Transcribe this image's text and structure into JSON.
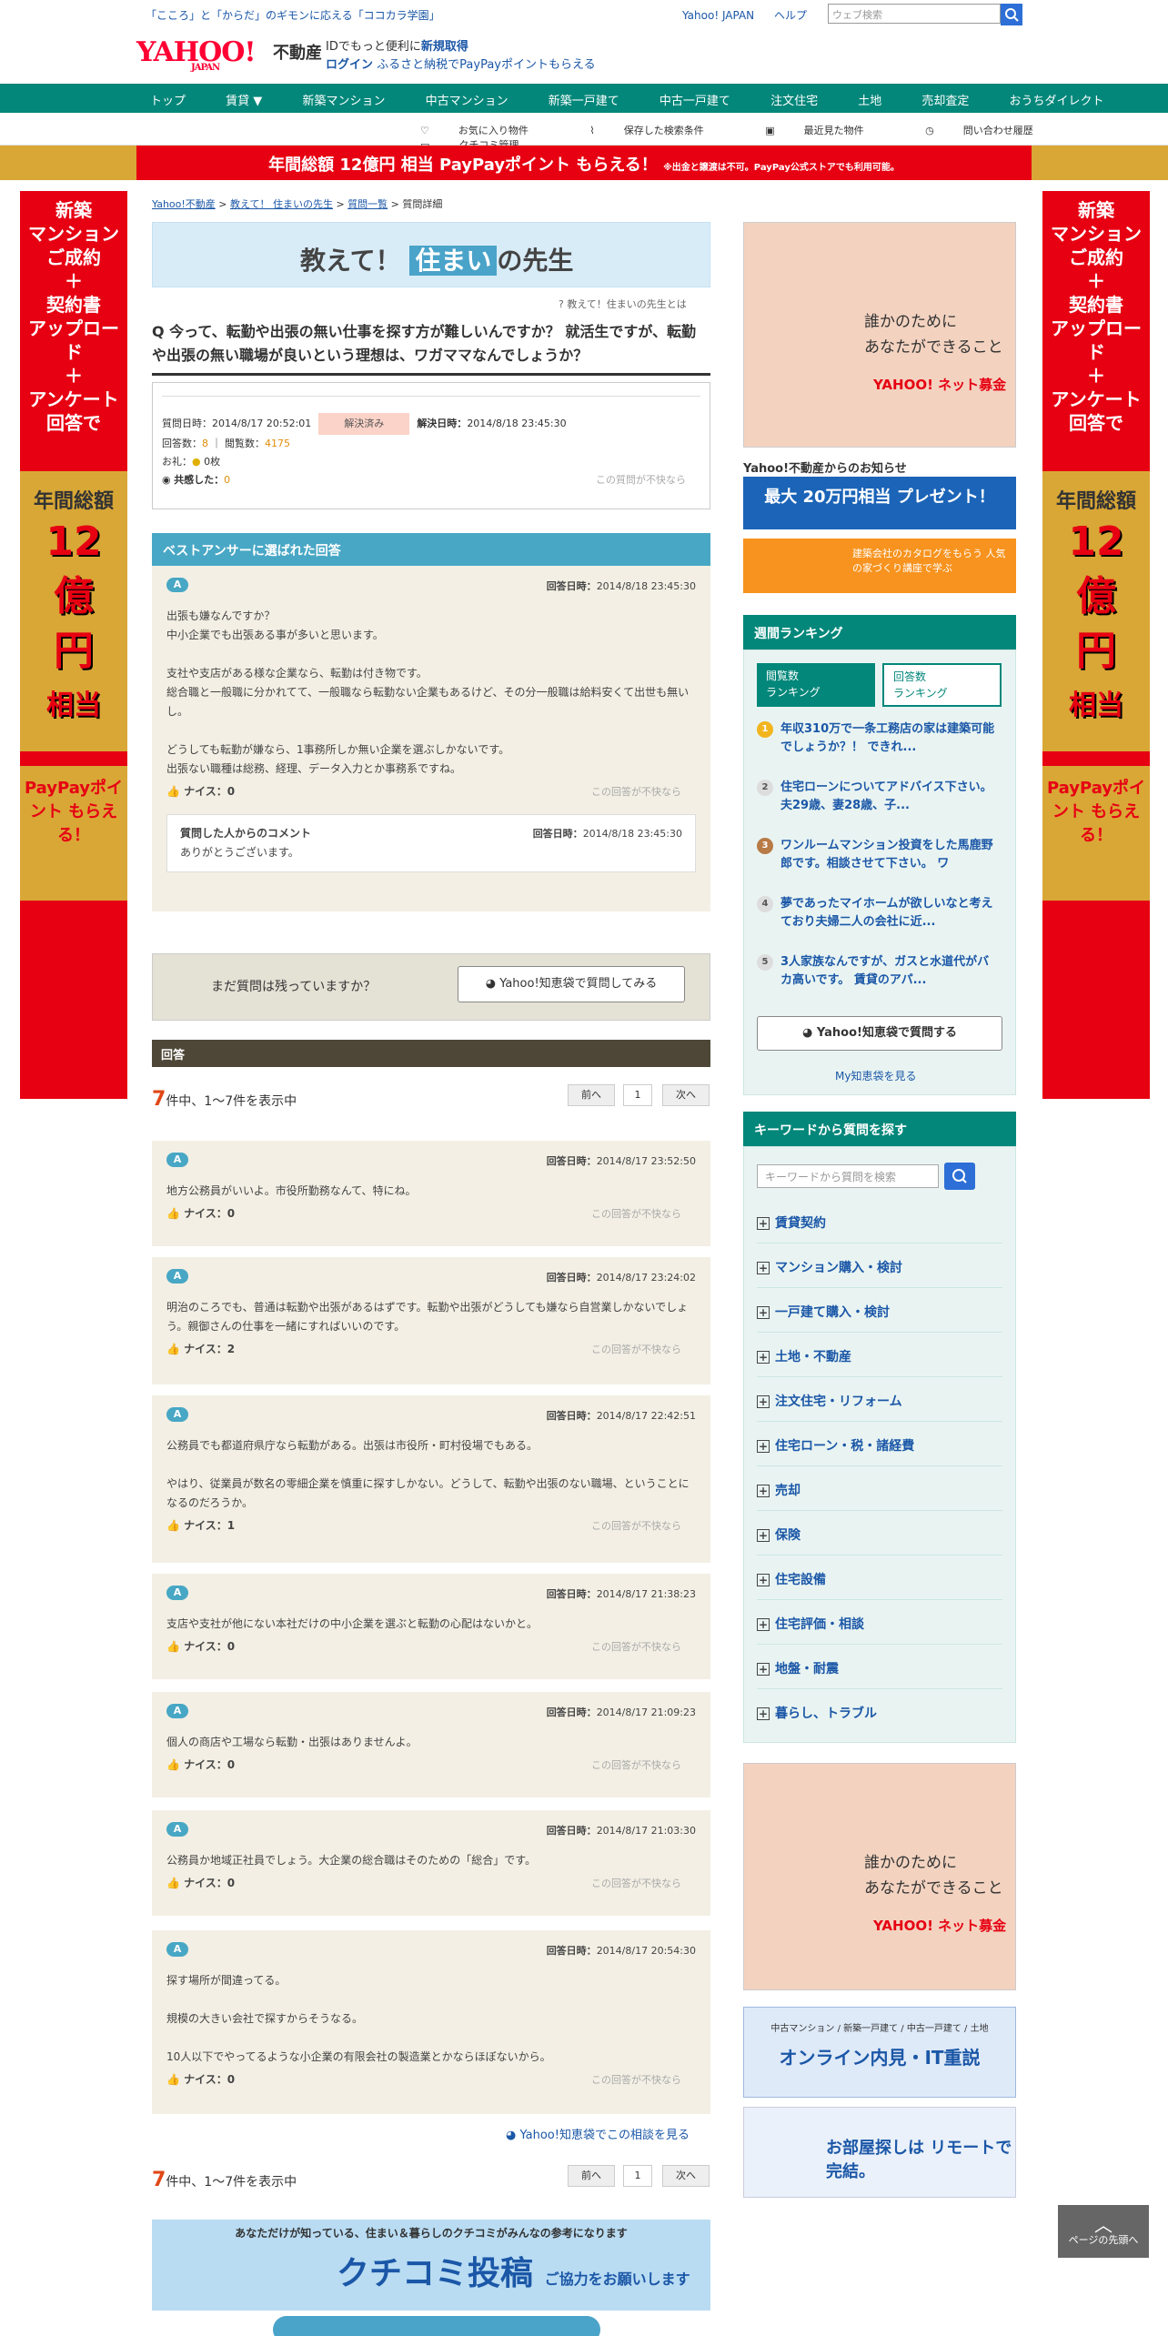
{
  "header": {
    "tagline": "「こころ」と「からだ」のギモンに応える「ココカラ学園」",
    "links": [
      "Yahoo! JAPAN",
      "ヘルプ"
    ],
    "search_placeholder": "ウェブ検索",
    "logo": "YAHOO!",
    "logo_sub": "JAPAN",
    "site_name": "不動産",
    "id_line1_a": "IDでもっと便利に",
    "id_line1_b": "新規取得",
    "id_line2_a": "ログイン",
    "id_line2_b": "ふるさと納税でPayPayポイントもらえる"
  },
  "global_nav": [
    "トップ",
    "賃貸 ▼",
    "新築マンション",
    "中古マンション",
    "新築一戸建て",
    "中古一戸建て",
    "注文住宅",
    "土地",
    "売却査定",
    "おうちダイレクト"
  ],
  "sub_nav": [
    "お気に入り物件",
    "保存した検索条件",
    "最近見た物件",
    "問い合わせ履歴",
    "クチコミ管理"
  ],
  "banner": {
    "text": "年間総額 12億円 相当 PayPayポイント もらえる！",
    "note": "※出金と譲渡は不可。PayPay公式ストアでも利用可能。"
  },
  "side_ad": {
    "line1": "新築\nマンション\nご成約\n＋\n契約書\nアップロード\n＋\nアンケート\n回答で",
    "total": "年間総額",
    "amount": "12億円",
    "equiv": "相当",
    "paypay": "PayPayポイント もらえる！"
  },
  "breadcrumb": [
    "Yahoo!不動産",
    "教えて！ 住まいの先生",
    "質問一覧",
    "質問詳細"
  ],
  "hero": {
    "t1": "教えて！",
    "t2": "住まい",
    "t3": "の先生",
    "about": "教えて！住まいの先生とは"
  },
  "question": {
    "title": "今って、転勤や出張の無い仕事を探す方が難しいんですか？ 就活生ですが、転勤や出張の無い職場が良いという理想は、ワガママなんでしょうか？",
    "asked_label": "質問日時：",
    "asked": "2014/8/17 20:52:01",
    "status": "解決済み",
    "resolved_label": "解決日時：",
    "resolved": "2014/8/18 23:45:30",
    "answers_label": "回答数：",
    "answers": "8",
    "views_label": "閲覧数：",
    "views": "4175",
    "thanks_label": "お礼：",
    "thanks": "0枚",
    "empathy_label": "共感した：",
    "empathy": "0",
    "inappropriate": "この質問が不快なら"
  },
  "best": {
    "header": "ベストアンサーに選ばれた回答",
    "date_label": "回答日時：",
    "date": "2014/8/18 23:45:30",
    "body": "出張も嫌なんですか？\n中小企業でも出張ある事が多いと思います。\n\n支社や支店がある様な企業なら、転勤は付き物です。\n総合職と一般職に分かれてて、一般職なら転勤ない企業もあるけど、その分一般職は給料安くて出世も無いし。\n\nどうしても転勤が嫌なら、1事務所しか無い企業を選ぶしかないです。\n出張ない職種は総務、経理、データ入力とか事務系ですね。",
    "nice": "ナイス：0",
    "inappropriate": "この回答が不快なら",
    "comment_title": "質問した人からのコメント",
    "comment_date_label": "回答日時：",
    "comment_date": "2014/8/18 23:45:30",
    "comment_body": "ありがとうございます。"
  },
  "more_q": {
    "text": "まだ質問は残っていますか？",
    "button": "Yahoo!知恵袋で質問してみる"
  },
  "answers_header": "回答",
  "count": {
    "num": "7",
    "text": "件中、1～7件を表示中"
  },
  "pager": {
    "prev": "前へ",
    "page": "1",
    "next": "次へ"
  },
  "answers": [
    {
      "date": "2014/8/17 23:52:50",
      "body": "地方公務員がいいよ。市役所勤務なんて、特にね。",
      "nice": "ナイス：0"
    },
    {
      "date": "2014/8/17 23:24:02",
      "body": "明治のころでも、普通は転勤や出張があるはずです。転勤や出張がどうしても嫌なら自営業しかないでしょう。親御さんの仕事を一緒にすればいいのです。",
      "nice": "ナイス：2"
    },
    {
      "date": "2014/8/17 22:42:51",
      "body": "公務員でも都道府県庁なら転勤がある。出張は市役所・町村役場でもある。\n\nやはり、従業員が数名の零細企業を慎重に探すしかない。どうして、転勤や出張のない職場、ということになるのだろうか。",
      "nice": "ナイス：1"
    },
    {
      "date": "2014/8/17 21:38:23",
      "body": "支店や支社が他にない本社だけの中小企業を選ぶと転勤の心配はないかと。",
      "nice": "ナイス：0"
    },
    {
      "date": "2014/8/17 21:09:23",
      "body": "個人の商店や工場なら転勤・出張はありませんよ。",
      "nice": "ナイス：0"
    },
    {
      "date": "2014/8/17 21:03:30",
      "body": "公務員か地域正社員でしょう。大企業の総合職はそのための「総合」です。",
      "nice": "ナイス：0"
    },
    {
      "date": "2014/8/17 20:54:30",
      "body": "探す場所が間違ってる。\n\n規模の大きい会社で探すからそうなる。\n\n10人以下でやってるような小企業の有限会社の製造業とかならほぼないから。",
      "nice": "ナイス：0"
    }
  ],
  "answer_labels": {
    "date_label": "回答日時：",
    "inappropriate": "この回答が不快なら",
    "badge": "A"
  },
  "see_more": "Yahoo!知恵袋でこの相談を見る",
  "kuchikomi": {
    "line": "あなただけが知っている、住まい＆暮らしのクチコミがみんなの参考になります",
    "big": "クチコミ投稿",
    "sub": "ご協力をお願いします"
  },
  "right": {
    "ad1_text": "誰かのために\nあなたができること",
    "ad1_brand": "YAHOO! ネット募金",
    "notice_title": "Yahoo!不動産からのお知らせ",
    "notice1": "最大 20万円相当 プレゼント！",
    "notice2": "建築会社のカタログをもらう 人気の家づくり講座で学ぶ",
    "rank_title": "週間ランキング",
    "rank_tab1": "閲覧数\nランキング",
    "rank_tab2": "回答数\nランキング",
    "ranking": [
      {
        "n": "1",
        "t": "年収310万で一条工務店の家は建築可能でしょうか？！ できれ..."
      },
      {
        "n": "2",
        "t": "住宅ローンについてアドバイス下さい。 夫29歳、妻28歳、子..."
      },
      {
        "n": "3",
        "t": "ワンルームマンション投資をした馬鹿野郎です。相談させて下さい。 ワ"
      },
      {
        "n": "4",
        "t": "夢であったマイホームが欲しいなと考えており夫婦二人の会社に近..."
      },
      {
        "n": "5",
        "t": "3人家族なんですが、ガスと水道代がバカ高いです。 賃貸のアパ..."
      }
    ],
    "rank_button": "Yahoo!知恵袋で質問する",
    "my_chie": "My知恵袋を見る",
    "kw_title": "キーワードから質問を探す",
    "kw_placeholder": "キーワードから質問を検索",
    "categories": [
      "賃貸契約",
      "マンション購入・検討",
      "一戸建て購入・検討",
      "土地・不動産",
      "注文住宅・リフォーム",
      "住宅ローン・税・諸経費",
      "売却",
      "保険",
      "住宅設備",
      "住宅評価・相談",
      "地盤・耐震",
      "暮らし、トラブル"
    ],
    "ad3_title": "オンライン内見・IT重説",
    "ad3_sub": "中古マンション / 新築一戸建て / 中古一戸建て / 土地",
    "ad4_title": "お部屋探しは リモートで完結。",
    "to_top": "ページの先頭へ"
  }
}
